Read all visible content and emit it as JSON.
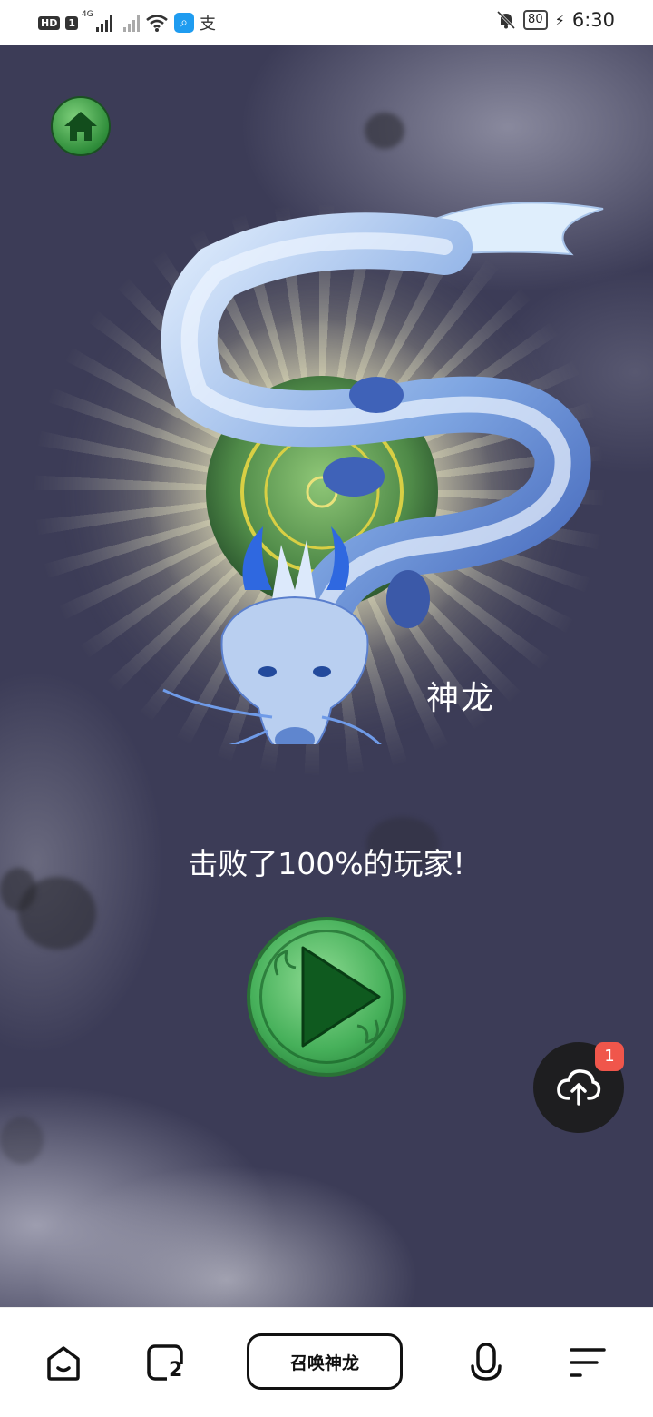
{
  "status_bar": {
    "badges": [
      "HD",
      "1"
    ],
    "network": "4G",
    "search_icon": "search-app-icon",
    "alipay_icon": "支",
    "battery": "80",
    "time": "6:30"
  },
  "game": {
    "creature_name": "神龙",
    "result_text": "击败了100%的玩家!",
    "home_icon": "home-icon",
    "play_icon": "play-icon",
    "upload_badge": "1",
    "colors": {
      "background": "#3c3c57",
      "button_green": "#46b05a",
      "badge_red": "#f0564b"
    }
  },
  "bottom_bar": {
    "main_button": "召唤神龙",
    "tabs_count_badge": "2",
    "icons": [
      "home-tab-icon",
      "tabs-icon",
      "microphone-icon",
      "menu-icon"
    ]
  }
}
